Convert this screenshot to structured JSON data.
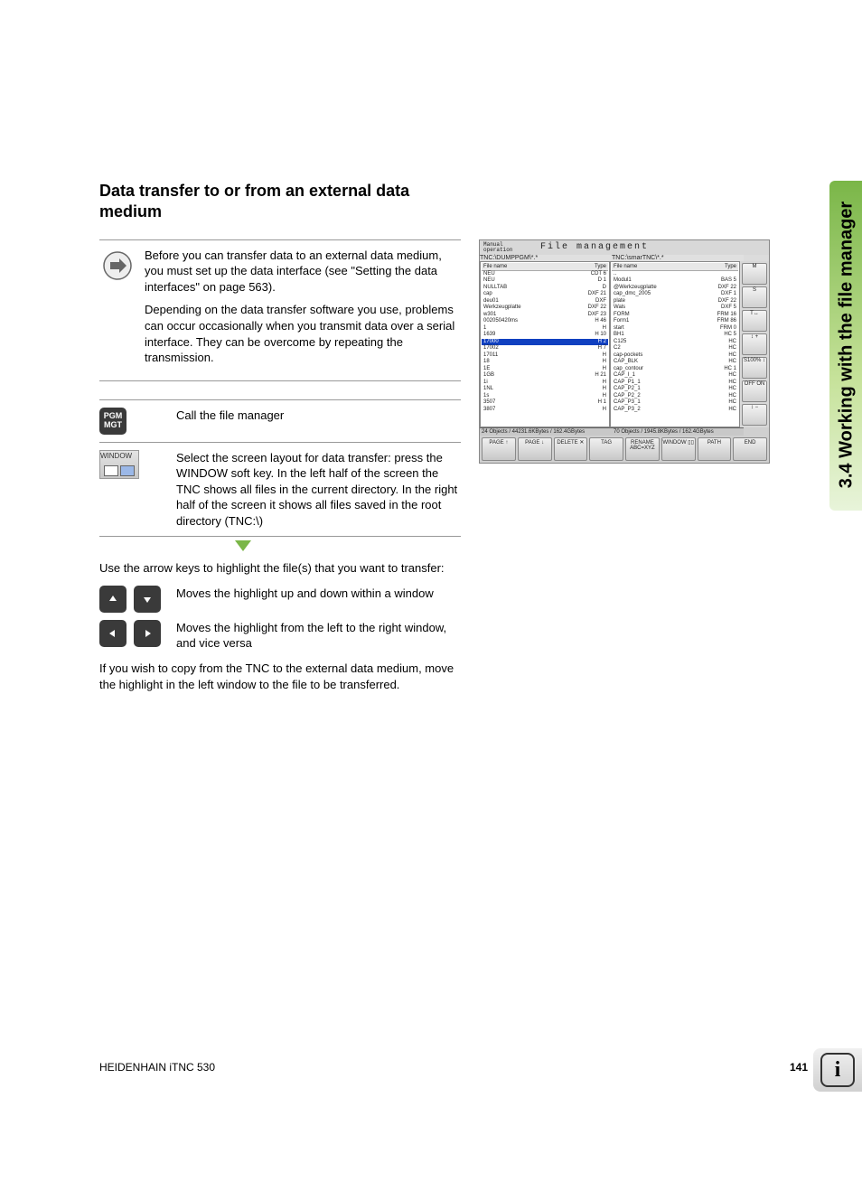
{
  "sideTab": "3.4 Working with the file manager",
  "heading": "Data transfer to or from an external data medium",
  "note": {
    "p1": "Before you can transfer data to an external data medium, you must set up the data interface (see \"Setting the data interfaces\" on page 563).",
    "p2": "Depending on the data transfer software you use, problems can occur occasionally when you transmit data over a serial interface. They can be overcome by repeating the transmission."
  },
  "steps": [
    {
      "iconLabel": "PGM\nMGT",
      "text": "Call the file manager"
    },
    {
      "iconLabel": "WINDOW",
      "text": "Select the screen layout for data transfer: press the WINDOW soft key. In the left half of the screen the TNC shows all files in the current directory. In the right half of the screen it shows all files saved in the root directory (TNC:\\)"
    }
  ],
  "para1": "Use the arrow keys to highlight the file(s) that you want to transfer:",
  "keyRows": [
    {
      "desc": "Moves the highlight up and down within a window"
    },
    {
      "desc": "Moves the highlight from the left to the right window, and vice versa"
    }
  ],
  "para2": "If you wish to copy from the TNC to the external data medium, move the highlight in the left window to the file to be transferred.",
  "screenshot": {
    "mode": "Manual operation",
    "title": "File management",
    "leftPath": "TNC:\\DUMPPGM\\*.*",
    "rightPath": "TNC:\\smarTNC\\*.*",
    "colHeaderL": "File name",
    "colHeaderR": "File name",
    "colType": "Type",
    "leftRows": [
      {
        "n": "NEU",
        "t": "CDT",
        "s": "6"
      },
      {
        "n": "NEU",
        "t": "D",
        "s": "1"
      },
      {
        "n": "NULLTAB",
        "t": "D",
        "s": ""
      },
      {
        "n": "cap",
        "t": "DXF",
        "s": "21"
      },
      {
        "n": "deu01",
        "t": "DXF",
        "s": ""
      },
      {
        "n": "Werkzeugplatte",
        "t": "DXF",
        "s": "22"
      },
      {
        "n": "w301",
        "t": "DXF",
        "s": "23"
      },
      {
        "n": "002050420ms",
        "t": "H",
        "s": "46"
      },
      {
        "n": "1",
        "t": "H",
        "s": ""
      },
      {
        "n": "1639",
        "t": "H",
        "s": "10"
      },
      {
        "n": "17000",
        "t": "H",
        "s": "2",
        "sel": true
      },
      {
        "n": "17002",
        "t": "H",
        "s": "7"
      },
      {
        "n": "17011",
        "t": "H",
        "s": ""
      },
      {
        "n": "18",
        "t": "H",
        "s": ""
      },
      {
        "n": "1E",
        "t": "H",
        "s": ""
      },
      {
        "n": "1GB",
        "t": "H",
        "s": "21"
      },
      {
        "n": "1i",
        "t": "H",
        "s": ""
      },
      {
        "n": "1NL",
        "t": "H",
        "s": ""
      },
      {
        "n": "1s",
        "t": "H",
        "s": ""
      },
      {
        "n": "3507",
        "t": "H",
        "s": "1"
      },
      {
        "n": "3807",
        "t": "H",
        "s": ""
      }
    ],
    "rightRows": [
      {
        "n": "..",
        "t": "",
        "s": ""
      },
      {
        "n": "Modul1",
        "t": "BAS",
        "s": "5"
      },
      {
        "n": "@Werkzeugplatte",
        "t": "DXF",
        "s": "22"
      },
      {
        "n": "cap_dmc_2005",
        "t": "DXF",
        "s": "1"
      },
      {
        "n": "plate",
        "t": "DXF",
        "s": "22"
      },
      {
        "n": "Wals",
        "t": "DXF",
        "s": "5"
      },
      {
        "n": "FORM",
        "t": "FRM",
        "s": "16"
      },
      {
        "n": "Form1",
        "t": "FRM",
        "s": "86"
      },
      {
        "n": "start",
        "t": "FRM",
        "s": "0"
      },
      {
        "n": "BH1",
        "t": "HC",
        "s": "5"
      },
      {
        "n": "C125",
        "t": "HC",
        "s": ""
      },
      {
        "n": "C2",
        "t": "HC",
        "s": ""
      },
      {
        "n": "cap-pockets",
        "t": "HC",
        "s": ""
      },
      {
        "n": "CAP_BLK",
        "t": "HC",
        "s": ""
      },
      {
        "n": "cap_contour",
        "t": "HC",
        "s": "1"
      },
      {
        "n": "CAP_I_1",
        "t": "HC",
        "s": ""
      },
      {
        "n": "CAP_P1_1",
        "t": "HC",
        "s": ""
      },
      {
        "n": "CAP_P2_1",
        "t": "HC",
        "s": ""
      },
      {
        "n": "CAP_P2_2",
        "t": "HC",
        "s": ""
      },
      {
        "n": "CAP_P3_1",
        "t": "HC",
        "s": ""
      },
      {
        "n": "CAP_P3_2",
        "t": "HC",
        "s": ""
      }
    ],
    "statusL": "24 Objects / 44231.6KBytes / 162.4GBytes",
    "statusR": "70 Objects / 1945.8KBytes / 162.4GBytes",
    "softkeys": [
      "PAGE ↑",
      "PAGE ↓",
      "DELETE ✕",
      "TAG",
      "RENAME ABC=XYZ",
      "WINDOW ▯▯",
      "PATH",
      "END"
    ],
    "sideBtns": [
      "M",
      "S",
      "T↔",
      "↕ +",
      "S100% ↕",
      "OFF ON",
      "↕ −"
    ]
  },
  "footer": {
    "product": "HEIDENHAIN iTNC 530",
    "page": "141"
  }
}
